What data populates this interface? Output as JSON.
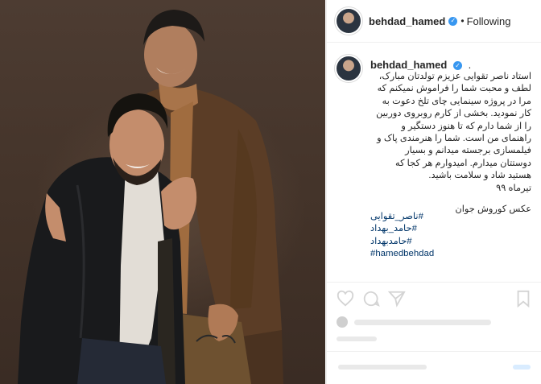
{
  "post": {
    "username": "behdad_hamed",
    "follow_status": "Following",
    "separator": "•",
    "caption_suffix": ".",
    "caption_lines": [
      "استاد ناصر تقوایی عزیزم تولدتان مبارک،",
      "لطف و محبت شما را فراموش نمیکنم که",
      "مرا در پروژه‌ سینمایی چای تلخ دعوت به",
      "کار نمودید. بخشی از کارم روبروی دوربین",
      "را از شما دارم که تا هنوز دستگیر و",
      "راهنمای من است. شما را هنرمندی پاک و",
      "فیلمسازی برجسته میدانم و بسیار",
      "دوستتان میدارم. امیدوارم هر کجا که",
      "هستید شاد و سلامت باشید.",
      "تیرماه ۹۹"
    ],
    "photo_credit": "عکس کوروش جوان",
    "hashtags": [
      "#ناصر_تقوایی",
      "#حامد_بهداد",
      "#حامدبهداد",
      "#hamedbehdad"
    ]
  },
  "icons": {
    "verified": "verified-badge-icon",
    "more": "more-options-icon",
    "like": "heart-icon",
    "comment": "comment-bubble-icon",
    "share": "paper-plane-icon",
    "save": "bookmark-icon"
  },
  "colors": {
    "verified_blue": "#3897f0",
    "hashtag_blue": "#003569",
    "border": "#efefef"
  }
}
